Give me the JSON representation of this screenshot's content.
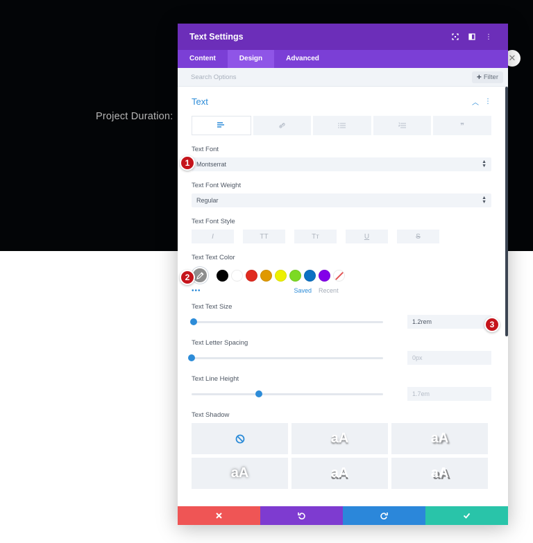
{
  "background": {
    "label": "Project Duration:",
    "colors": {
      "dark": "#030507",
      "light": "#ffffff"
    }
  },
  "modal": {
    "title": "Text Settings",
    "header_icons": [
      "expand-icon",
      "sidebar-icon",
      "more-vertical-icon"
    ],
    "tabs": [
      {
        "label": "Content",
        "active": false
      },
      {
        "label": "Design",
        "active": true
      },
      {
        "label": "Advanced",
        "active": false
      }
    ],
    "search": {
      "placeholder": "Search Options",
      "filter_label": "Filter"
    },
    "section": {
      "title": "Text"
    },
    "alignment_tabs": [
      "text-align-icon",
      "link-icon",
      "bullet-list-icon",
      "numbered-list-icon",
      "quote-icon"
    ],
    "fields": {
      "text_font": {
        "label": "Text Font",
        "value": "Montserrat"
      },
      "text_font_weight": {
        "label": "Text Font Weight",
        "value": "Regular"
      },
      "text_font_style": {
        "label": "Text Font Style",
        "buttons": [
          "I",
          "TT",
          "Tт",
          "U",
          "S"
        ]
      },
      "text_color": {
        "label": "Text Text Color",
        "swatches": [
          "#000000",
          "#ffffff",
          "#e02b20",
          "#e09900",
          "#edf000",
          "#7cda24",
          "#0c71c3",
          "#8300e9"
        ],
        "saved_label": "Saved",
        "recent_label": "Recent"
      },
      "text_size": {
        "label": "Text Text Size",
        "value": "1.2rem",
        "percent": 1
      },
      "letter_spacing": {
        "label": "Text Letter Spacing",
        "value": "0px",
        "percent": 0
      },
      "line_height": {
        "label": "Text Line Height",
        "value": "1.7em",
        "percent": 35
      },
      "text_shadow": {
        "label": "Text Shadow",
        "options": [
          "none",
          "aA",
          "aA",
          "aA",
          "aA",
          "aA"
        ]
      }
    },
    "footer_buttons": [
      "cancel",
      "undo",
      "redo",
      "save"
    ],
    "footer_colors": [
      "#ef5555",
      "#7e3bd0",
      "#2b87da",
      "#29c4a9"
    ]
  },
  "markers": [
    "1",
    "2",
    "3"
  ],
  "accent": "#2d8cd8",
  "brand": "#6c2eb9"
}
